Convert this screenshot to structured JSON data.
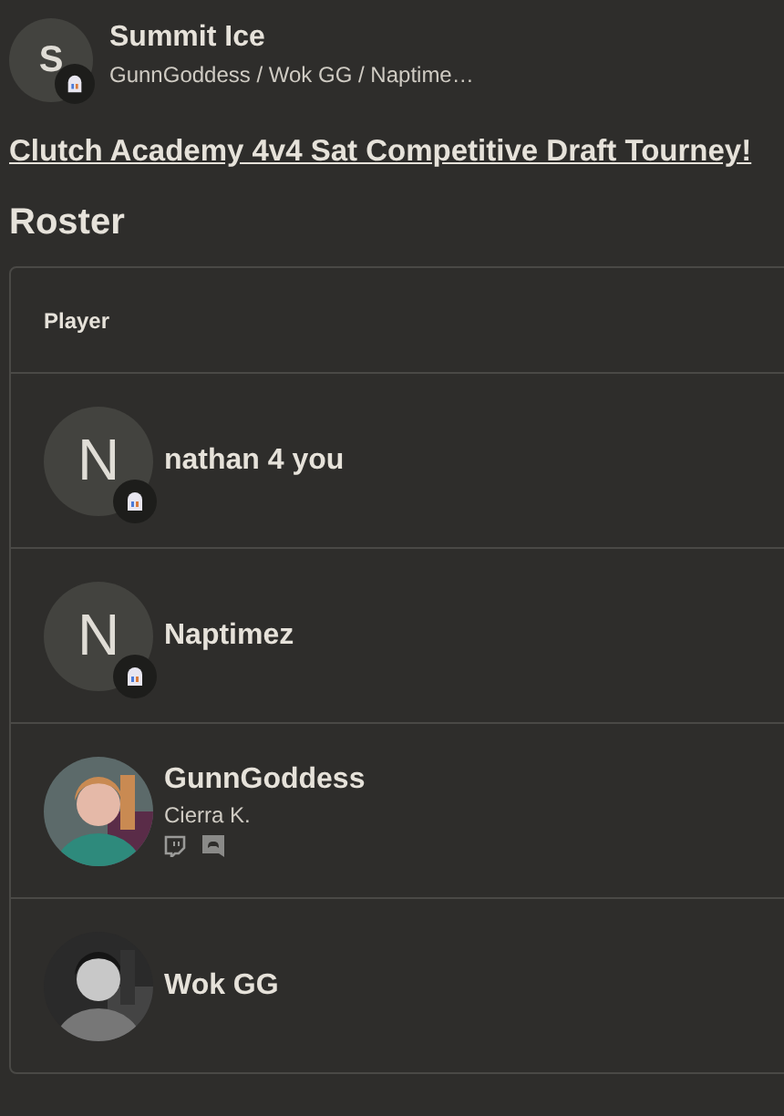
{
  "team": {
    "avatar": {
      "kind": "letter",
      "letter": "S",
      "badge": true
    },
    "name": "Summit Ice",
    "members": "GunnGoddess / Wok GG / Naptime…"
  },
  "event_link": "Clutch Academy 4v4 Sat Competitive Draft Tourney!",
  "section_title": "Roster",
  "table": {
    "columns": [
      "Player"
    ],
    "rows": [
      {
        "avatar": {
          "kind": "letter",
          "letter": "N",
          "badge": true
        },
        "name": "nathan 4 you"
      },
      {
        "avatar": {
          "kind": "letter",
          "letter": "N",
          "badge": true
        },
        "name": "Naptimez"
      },
      {
        "name": "GunnGoddess",
        "real_name": "Cierra K.",
        "socials": [
          {
            "kind": "twitch"
          },
          {
            "kind": "discord"
          }
        ]
      },
      {
        "name": "Wok GG"
      }
    ]
  }
}
